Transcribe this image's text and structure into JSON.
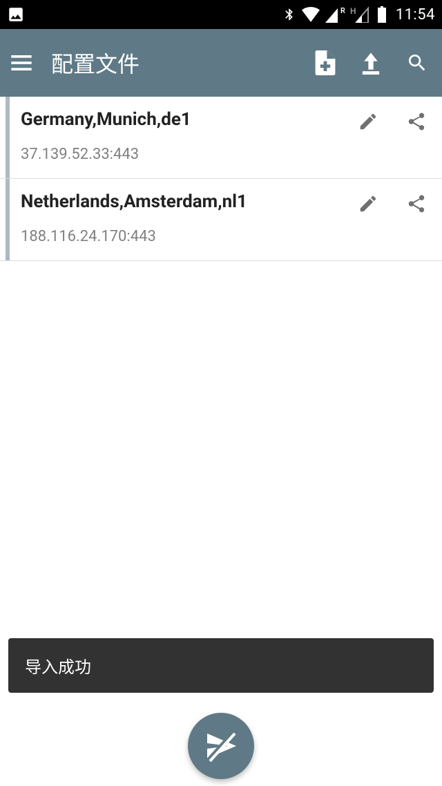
{
  "status": {
    "time": "11:54"
  },
  "header": {
    "title": "配置文件"
  },
  "profiles": [
    {
      "name": "Germany,Munich,de1",
      "address": "37.139.52.33:443"
    },
    {
      "name": "Netherlands,Amsterdam,nl1",
      "address": "188.116.24.170:443"
    }
  ],
  "snackbar": {
    "message": "导入成功"
  }
}
